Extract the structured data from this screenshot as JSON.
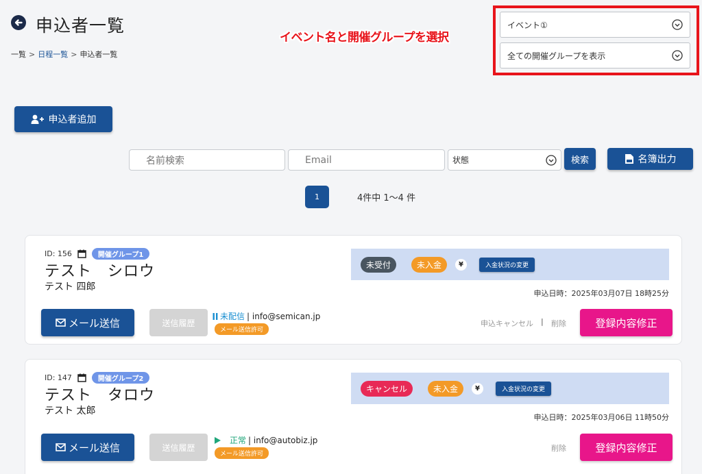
{
  "header": {
    "title": "申込者一覧",
    "breadcrumb": {
      "home": "一覧",
      "schedule": "日程一覧",
      "current": "申込者一覧",
      "separator": ">"
    }
  },
  "filters": {
    "event_select": "イベント①",
    "group_select": "全ての開催グループを表示",
    "annotation": "イベント名と開催グループを選択"
  },
  "toolbar": {
    "add_label": "申込者追加",
    "name_placeholder": "名前検索",
    "email_placeholder": "Email",
    "status_select": "状態",
    "search_label": "検索",
    "export_label": "名簿出力"
  },
  "pagination": {
    "current_page": "1",
    "summary": "4件中 1〜4 件"
  },
  "applicants": [
    {
      "id_label": "ID: 156",
      "group": "開催グループ1",
      "name_kana": "テスト　シロウ",
      "name_kanji": "テスト 四郎",
      "reception_status": "未受付",
      "payment_status": "未入金",
      "yen": "¥",
      "change_label": "入金状況の変更",
      "applied_at": "申込日時：2025年03月07日 18時25分",
      "mail_label": "メール送信",
      "history_label": "送信履歴",
      "mail_status": "未配信",
      "email": "| info@semican.jp",
      "mail_permission": "メール送信許可",
      "cancel_label": "申込キャンセル",
      "action_sep": "|",
      "delete_label": "削除",
      "edit_label": "登録内容修正"
    },
    {
      "id_label": "ID: 147",
      "group": "開催グループ2",
      "name_kana": "テスト　タロウ",
      "name_kanji": "テスト 太郎",
      "reception_status": "キャンセル",
      "payment_status": "未入金",
      "yen": "¥",
      "change_label": "入金状況の変更",
      "applied_at": "申込日時：2025年03月06日 11時50分",
      "mail_label": "メール送信",
      "history_label": "送信履歴",
      "mail_status": "正常",
      "email": "| info@autobiz.jp",
      "mail_permission": "メール送信許可",
      "delete_label": "削除",
      "edit_label": "登録内容修正"
    }
  ],
  "colors": {
    "primary": "#1a5296",
    "highlight": "#e8141b",
    "edit": "#e8168a",
    "orange": "#f39a27",
    "cancel": "#e82a56",
    "group_badge": "#6f95e8",
    "status_panel": "#cfdcf3"
  },
  "icons": [
    "back-arrow-icon",
    "chevron-down-icon",
    "add-user-icon",
    "csv-file-icon",
    "calendar-icon",
    "envelope-icon",
    "pause-icon",
    "play-icon"
  ]
}
